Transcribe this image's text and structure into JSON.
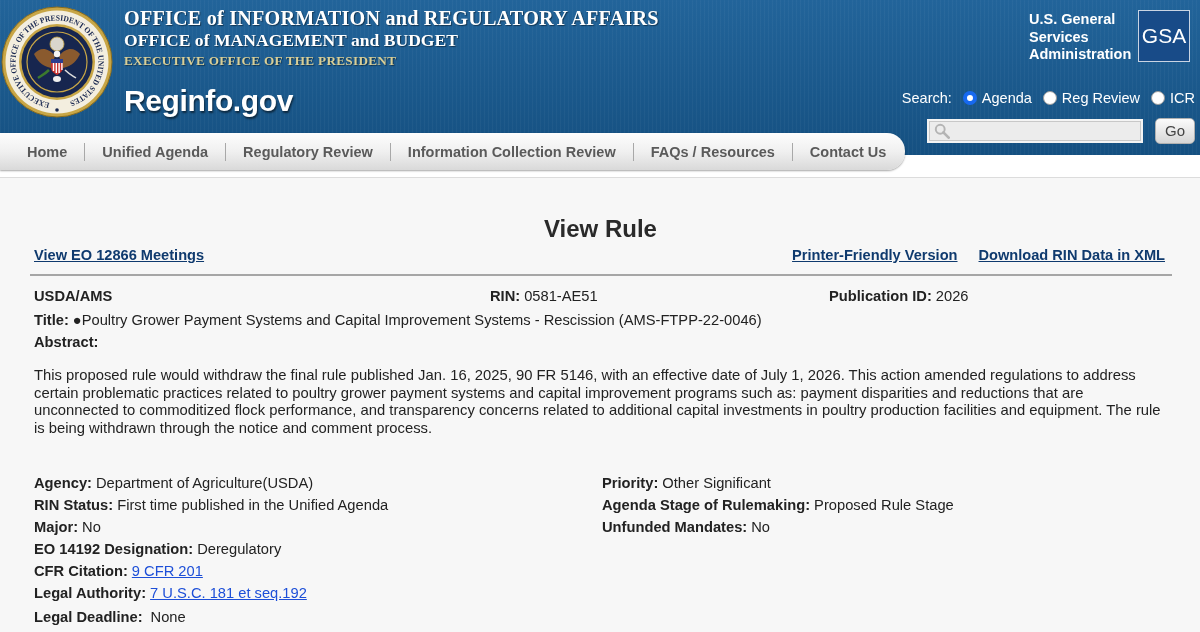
{
  "header": {
    "seal_text": "EXECUTIVE OFFICE OF THE PRESIDENT OF THE UNITED STATES",
    "office_title": "OFFICE of INFORMATION and REGULATORY AFFAIRS",
    "parent_office": "OFFICE of MANAGEMENT and BUDGET",
    "executive_office": "EXECUTIVE OFFICE OF THE PRESIDENT",
    "site_name": "Reginfo.gov",
    "gsa_name": "U.S. General Services Administration",
    "gsa_logo": "GSA"
  },
  "search": {
    "label": "Search:",
    "options": [
      {
        "label": "Agenda",
        "selected": true
      },
      {
        "label": "Reg Review",
        "selected": false
      },
      {
        "label": "ICR",
        "selected": false
      }
    ],
    "button": "Go"
  },
  "nav": [
    "Home",
    "Unified Agenda",
    "Regulatory Review",
    "Information Collection Review",
    "FAQs / Resources",
    "Contact Us"
  ],
  "page": {
    "heading": "View Rule",
    "left_links": [
      "View EO 12866 Meetings"
    ],
    "right_links": [
      "Printer-Friendly Version",
      "Download RIN Data in XML"
    ]
  },
  "summary": {
    "agency_code": "USDA/AMS",
    "fields": [
      {
        "label": "RIN:",
        "value": "0581-AE51"
      },
      {
        "label": "Publication ID:",
        "value": "2026"
      }
    ]
  },
  "title": {
    "label": "Title:",
    "value": "●Poultry Grower Payment Systems and Capital Improvement Systems - Rescission (AMS-FTPP-22-0046)"
  },
  "abstract": {
    "label": "Abstract:",
    "text": "This proposed rule would withdraw the final rule published Jan. 16, 2025, 90 FR 5146, with an effective date of July 1, 2026. This action amended regulations to address certain problematic practices related to poultry grower payment systems and capital improvement programs such as: payment disparities and reductions that are unconnected to commoditized flock performance, and transparency concerns related to additional capital investments in poultry production facilities and equipment. The rule is being withdrawn through the notice and comment process."
  },
  "details": {
    "left": [
      {
        "label": "Agency:",
        "value": "Department of Agriculture(USDA)",
        "kind": "text"
      },
      {
        "label": "RIN Status:",
        "value": "First time published in the Unified Agenda",
        "kind": "text"
      },
      {
        "label": "Major:",
        "value": "No",
        "kind": "text"
      },
      {
        "label": "EO 14192 Designation:",
        "value": "Deregulatory",
        "kind": "text"
      },
      {
        "label": "CFR Citation:",
        "value": "9 CFR 201",
        "kind": "link"
      },
      {
        "label": "Legal Authority:",
        "value": "7 U.S.C. 181 et seq.192",
        "kind": "link"
      },
      {
        "label": "Legal Deadline:",
        "value": "None",
        "kind": "text"
      }
    ],
    "right": [
      {
        "label": "Priority:",
        "value": "Other Significant",
        "kind": "text"
      },
      {
        "label": "Agenda Stage of Rulemaking:",
        "value": "Proposed Rule Stage",
        "kind": "text"
      },
      {
        "label": "Unfunded Mandates:",
        "value": "No",
        "kind": "text"
      }
    ]
  }
}
